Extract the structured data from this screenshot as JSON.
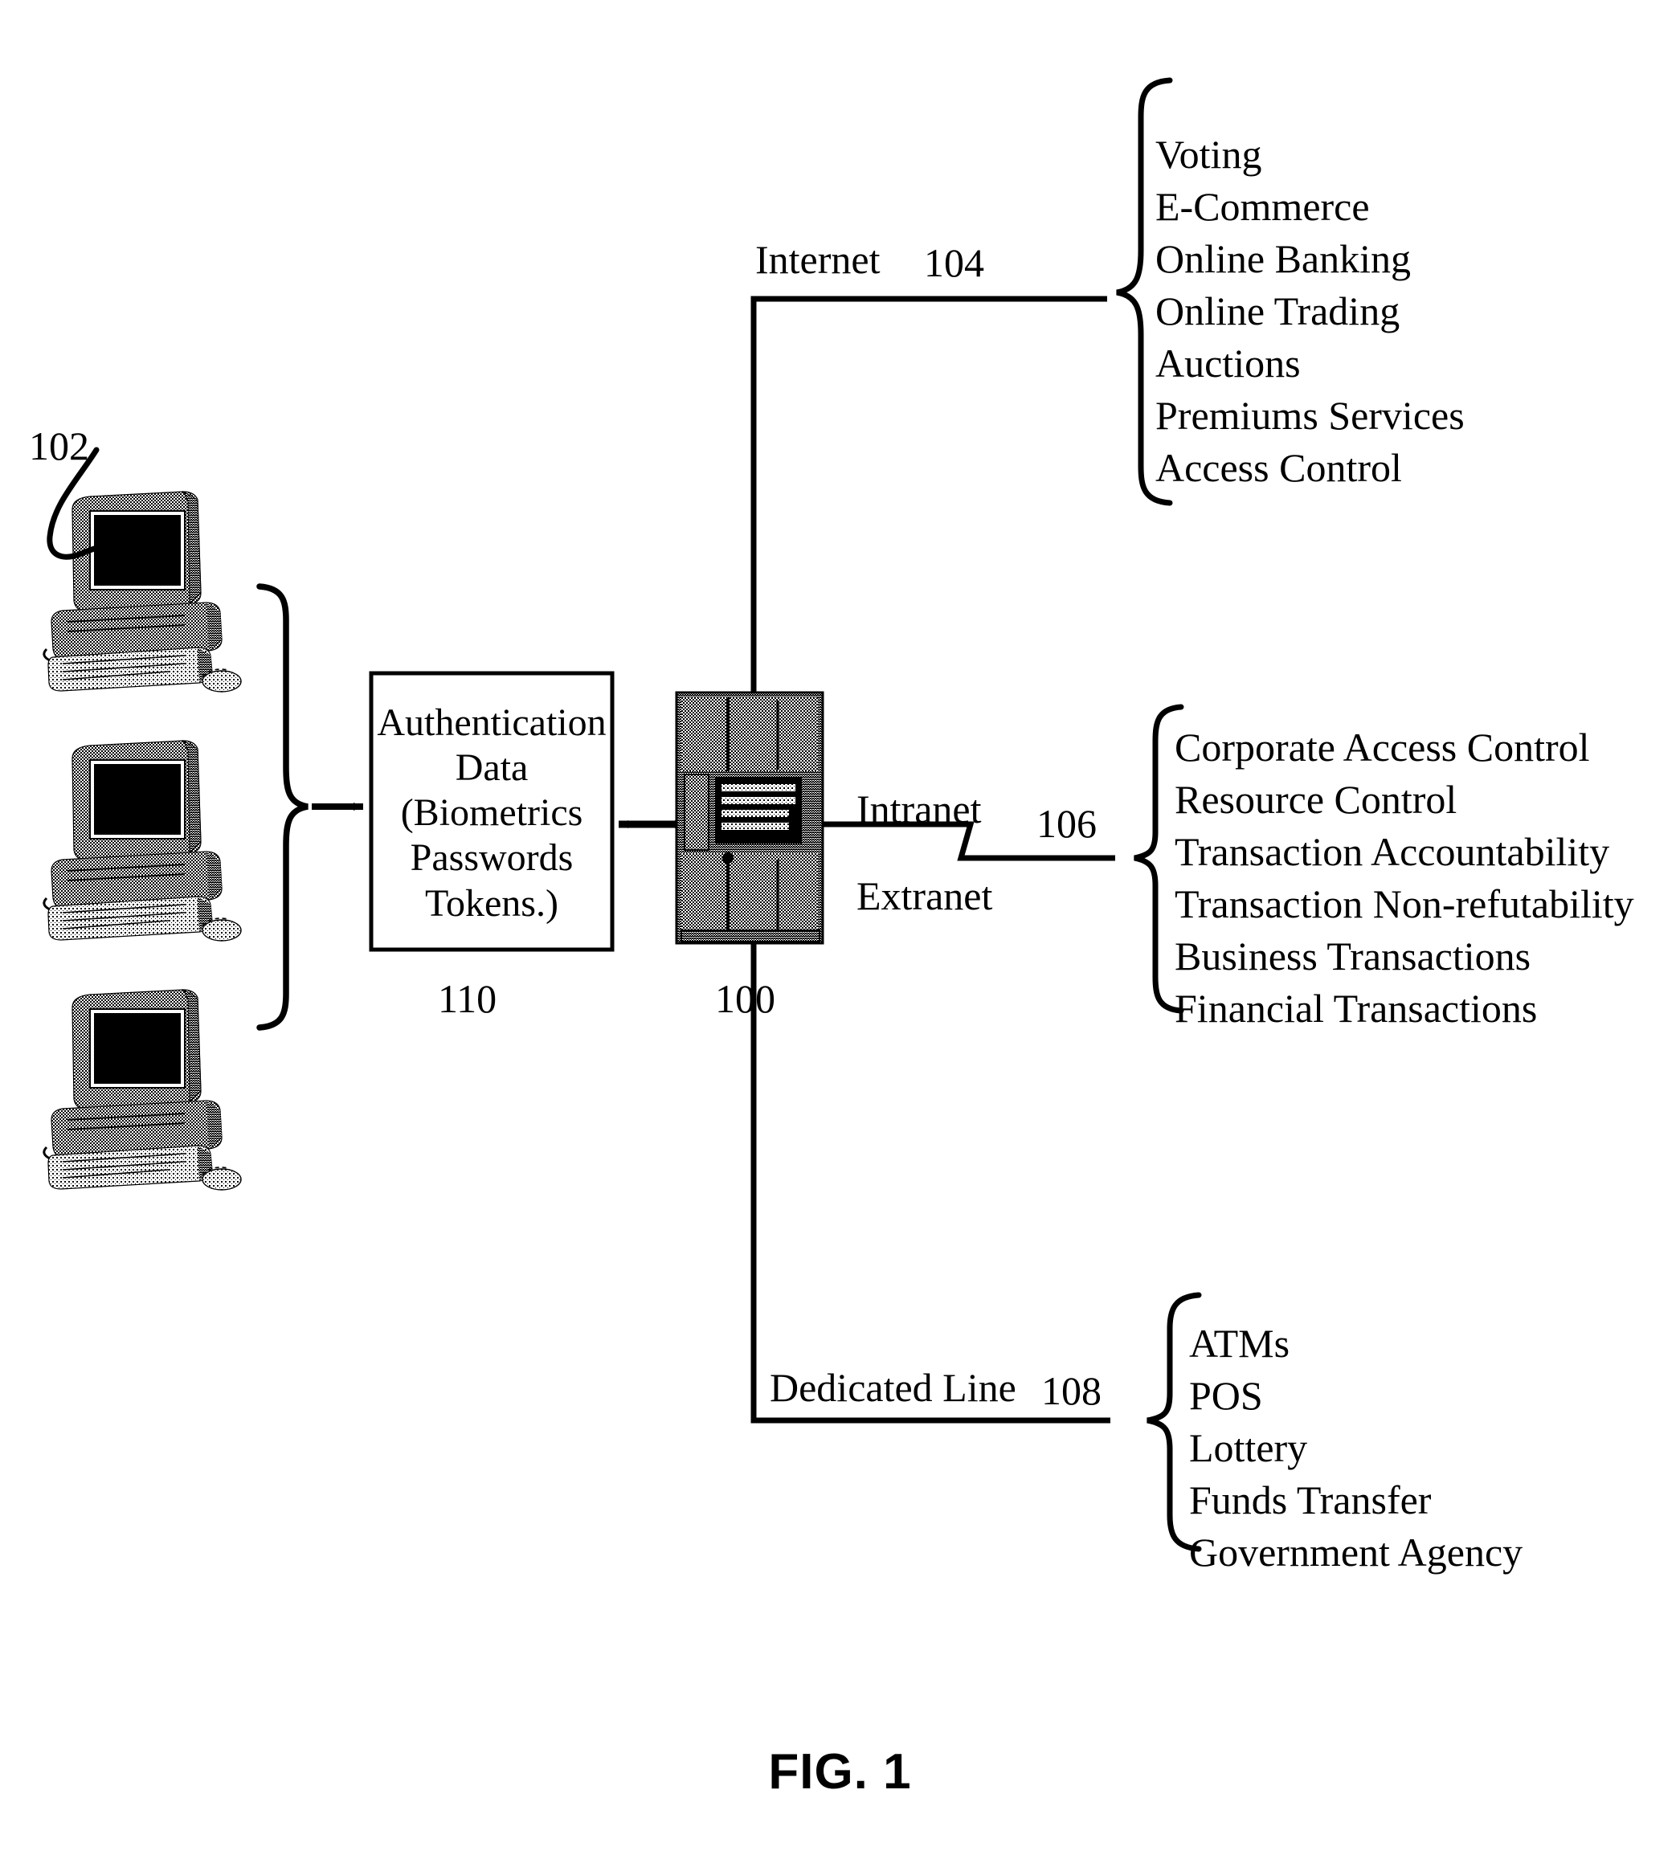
{
  "figure": {
    "caption": "FIG. 1",
    "reference_numerals": {
      "clients": "102",
      "internet": "104",
      "intranet_extranet": "106",
      "dedicated_line": "108",
      "auth_data": "110",
      "server": "100"
    },
    "auth_box": {
      "lines": [
        "Authentication",
        "Data",
        "(Biometrics",
        "Passwords",
        "Tokens.)"
      ]
    },
    "network_labels": {
      "internet": "Internet",
      "intranet": "Intranet",
      "extranet": "Extranet",
      "dedicated_line": "Dedicated Line"
    },
    "branches": [
      {
        "id": "internet",
        "label": "Internet",
        "ref": "104",
        "services": [
          "Voting",
          "E-Commerce",
          "Online Banking",
          "Online Trading",
          "Auctions",
          "Premiums Services",
          "Access Control"
        ]
      },
      {
        "id": "intranet-extranet",
        "label": "Intranet",
        "label2": "Extranet",
        "ref": "106",
        "services": [
          "Corporate Access Control",
          "Resource Control",
          "Transaction Accountability",
          "Transaction Non-refutability",
          "Business Transactions",
          "Financial Transactions"
        ]
      },
      {
        "id": "dedicated-line",
        "label": "Dedicated Line",
        "ref": "108",
        "services": [
          "ATMs",
          "POS",
          "Lottery",
          "Funds Transfer",
          " Government Agency"
        ]
      }
    ],
    "icons": {
      "client": "desktop-computer-icon",
      "server": "server-tower-icon"
    },
    "colors": {
      "ink": "#000000",
      "paper": "#ffffff"
    }
  }
}
